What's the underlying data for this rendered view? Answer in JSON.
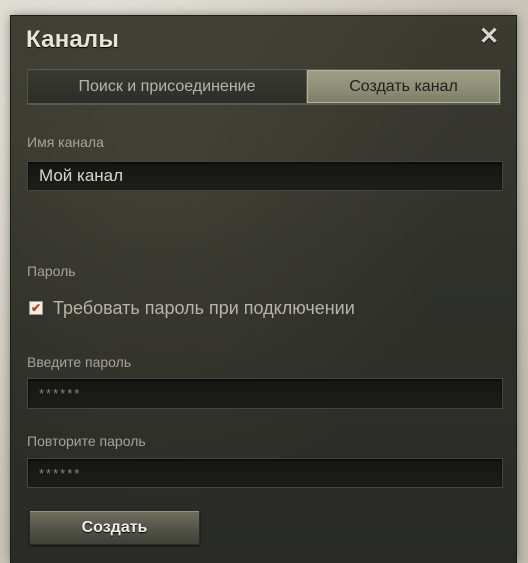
{
  "window": {
    "title": "Каналы",
    "close_icon": "close-icon"
  },
  "tabs": [
    {
      "label": "Поиск и присоединение",
      "active": false
    },
    {
      "label": "Создать канал",
      "active": true
    }
  ],
  "form": {
    "channel_name_label": "Имя канала",
    "channel_name_value": "Мой канал",
    "password_section_label": "Пароль",
    "require_password_label": "Требовать пароль при подключении",
    "require_password_checked": true,
    "enter_password_label": "Введите пароль",
    "enter_password_value": "******",
    "repeat_password_label": "Повторите пароль",
    "repeat_password_value": "******",
    "create_button_label": "Создать"
  },
  "colors": {
    "window_bg": "#2f302a",
    "active_tab_bg": "#8e8f77",
    "checkmark": "#b8461c"
  }
}
